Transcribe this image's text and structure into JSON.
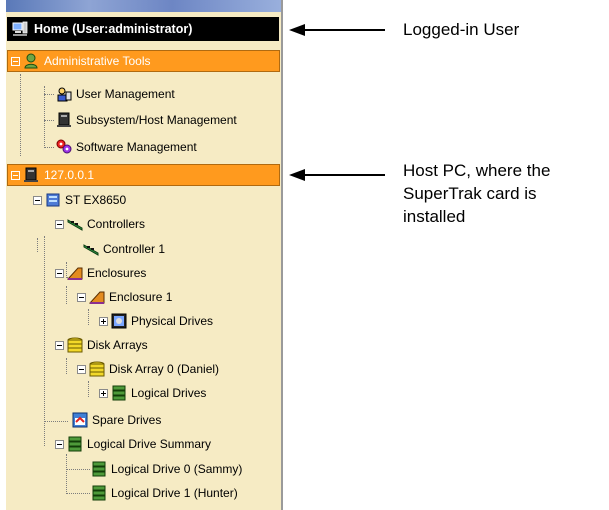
{
  "tree": {
    "home": "Home (User:administrator)",
    "admin_tools": "Administrative Tools",
    "user_mgmt": "User Management",
    "subsystem_mgmt": "Subsystem/Host Management",
    "software_mgmt": "Software Management",
    "host": "127.0.0.1",
    "subsystem": "ST EX8650",
    "controllers": "Controllers",
    "controller1": "Controller 1",
    "enclosures": "Enclosures",
    "enclosure1": "Enclosure 1",
    "physical_drives": "Physical Drives",
    "disk_arrays": "Disk Arrays",
    "disk_array0": "Disk Array 0 (Daniel)",
    "logical_drives": "Logical Drives",
    "spare_drives": "Spare Drives",
    "ld_summary": "Logical Drive Summary",
    "ld0": "Logical Drive 0 (Sammy)",
    "ld1": "Logical Drive 1 (Hunter)"
  },
  "annotations": {
    "logged_in_user": "Logged-in User",
    "host_line1": "Host PC, where the",
    "host_line2": "SuperTrak card is",
    "host_line3": "installed"
  },
  "colors": {
    "panel_bg": "#f6ebc4",
    "header_black": "#000000",
    "selected_orange": "#ff9a1e"
  },
  "icons": {
    "home": "home-computer-icon",
    "admin": "admin-user-icon",
    "user_mgmt": "user-management-icon",
    "subsystem": "subsystem-host-icon",
    "software": "software-gear-icon",
    "host": "host-pc-icon",
    "st": "subsystem-icon",
    "controller": "controller-card-icon",
    "enclosure": "enclosure-icon",
    "physical": "physical-drive-icon",
    "array": "disk-array-icon",
    "logical": "logical-drive-icon",
    "spare": "spare-drive-icon"
  }
}
